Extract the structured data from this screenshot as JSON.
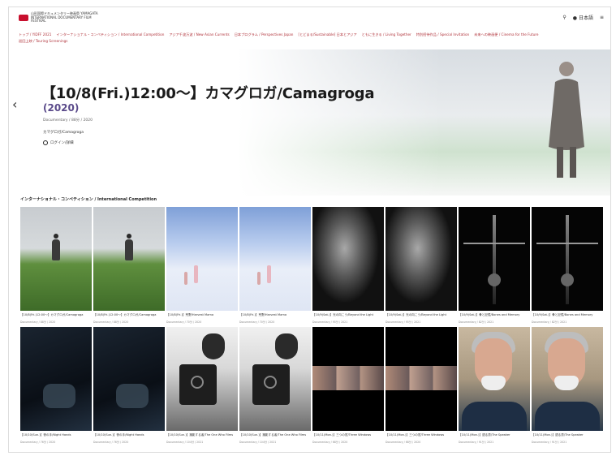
{
  "header": {
    "logo_text": "山形国際ドキュメンタリー映画祭 YAMAGATA INTERNATIONAL DOCUMENTARY FILM FESTIVAL",
    "search_icon": "search-icon",
    "lang_label": "日本語",
    "menu_label": "≡"
  },
  "nav": {
    "items": [
      "トップ / YIDFF 2021",
      "インターナショナル・コンペティション / International Competition",
      "アジア千波万波 / New Asian Currents",
      "日本プログラム / Perspectives Japan",
      "[とどまる/Sustainable] 日本とアジア",
      "ともに生きる / Living Together",
      "特別招待作品 / Special Invitation",
      "未来への映画便 / Cinema for the Future",
      "巡回上映 / Touring Screenings"
    ]
  },
  "hero": {
    "title": "【10/8(Fri.)12:00〜】カマグロガ/Camagroga",
    "year": "(2020)",
    "meta": "Documentary / 88分 / 2020",
    "subtitle": "カマグロガ/Camagroga",
    "cta": "ログイン/詳細",
    "slide_count": 20,
    "active_slide": 1
  },
  "section": {
    "title": "インターナショナル・コンペティション / International Competition"
  },
  "cards": [
    {
      "style": "field",
      "cap1": "【10/8(Fri.)12:00〜】カマグロガ/Camagroga",
      "cap2": "Documentary / 88分 / 2020"
    },
    {
      "style": "field",
      "cap1": "【10/8(Fri.)12:00〜】カマグロガ/Camagroga",
      "cap2": "Documentary / 88分 / 2020"
    },
    {
      "style": "sky",
      "cap1": "【10/8(Fri.)】荒野/Harvest Mama",
      "cap2": "Documentary / 70分 / 2020"
    },
    {
      "style": "sky",
      "cap1": "【10/8(Fri.)】荒野/Harvest Mama",
      "cap2": "Documentary / 70分 / 2020"
    },
    {
      "style": "dark",
      "cap1": "【10/9(Sat.)】光の向こう/Beyond the Light",
      "cap2": "Documentary / 95分 / 2021"
    },
    {
      "style": "dark",
      "cap1": "【10/9(Sat.)】光の向こう/Beyond the Light",
      "cap2": "Documentary / 95分 / 2021"
    },
    {
      "style": "skel",
      "cap1": "【10/9(Sat.)】骨と記憶/Bones and Memory",
      "cap2": "Documentary / 82分 / 2021"
    },
    {
      "style": "skel",
      "cap1": "【10/9(Sat.)】骨と記憶/Bones and Memory",
      "cap2": "Documentary / 82分 / 2021"
    },
    {
      "style": "night",
      "cap1": "【10/10(Sun.)】夜の手/Night Hands",
      "cap2": "Documentary / 76分 / 2020"
    },
    {
      "style": "night",
      "cap1": "【10/10(Sun.)】夜の手/Night Hands",
      "cap2": "Documentary / 76分 / 2020"
    },
    {
      "style": "bw",
      "cap1": "【10/10(Sun.)】撮影する者/The One Who Films",
      "cap2": "Documentary / 104分 / 2021"
    },
    {
      "style": "bw",
      "cap1": "【10/10(Sun.)】撮影する者/The One Who Films",
      "cap2": "Documentary / 104分 / 2021"
    },
    {
      "style": "film",
      "cap1": "【10/11(Mon.)】三つの窓/Three Windows",
      "cap2": "Documentary / 68分 / 2020"
    },
    {
      "style": "film",
      "cap1": "【10/11(Mon.)】三つの窓/Three Windows",
      "cap2": "Documentary / 68分 / 2020"
    },
    {
      "style": "man",
      "cap1": "【10/11(Mon.)】語る男/The Speaker",
      "cap2": "Documentary / 91分 / 2021"
    },
    {
      "style": "man",
      "cap1": "【10/11(Mon.)】語る男/The Speaker",
      "cap2": "Documentary / 91分 / 2021"
    }
  ]
}
